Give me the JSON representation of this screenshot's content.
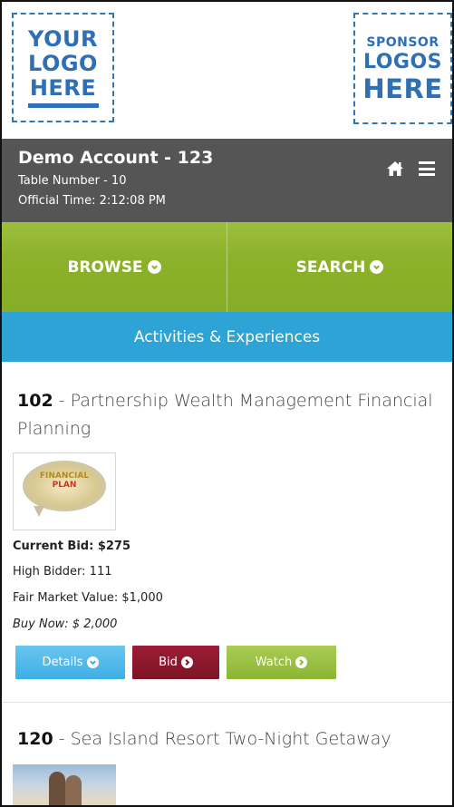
{
  "logos": {
    "left": {
      "line1": "YOUR",
      "line2": "LOGO",
      "line3": "HERE"
    },
    "right": {
      "line1": "SPONSOR",
      "line2": "LOGOS",
      "line3": "HERE"
    }
  },
  "account": {
    "name": "Demo Account - 123",
    "table": "Table Number - 10",
    "official_time": "Official Time: 2:12:08 PM",
    "icons": [
      "home-icon",
      "menu-icon"
    ]
  },
  "nav": {
    "browse_label": "BROWSE",
    "search_label": "SEARCH"
  },
  "category": {
    "label": "Activities & Experiences"
  },
  "items": [
    {
      "number": "102",
      "title_rest": " - Partnership Wealth Management Financial Planning",
      "thumb_text_1": "FINANCIAL",
      "thumb_text_2": "PLAN",
      "current_bid": "Current Bid: $275",
      "high_bidder": "High Bidder: 111",
      "fair_market_value": "Fair Market Value: $1,000",
      "buy_now": "Buy Now: $ 2,000",
      "buttons": {
        "details": "Details",
        "bid": "Bid",
        "watch": "Watch"
      }
    },
    {
      "number": "120",
      "title_rest": " - Sea Island Resort Two-Night Getaway"
    }
  ],
  "colors": {
    "account_bar": "#555555",
    "nav_green": "#8cb12b",
    "category_blue": "#2ea3d6",
    "details_blue": "#3eaee5",
    "bid_maroon": "#7d1426",
    "watch_green": "#8cb533",
    "logo_blue": "#2f6fb5"
  }
}
